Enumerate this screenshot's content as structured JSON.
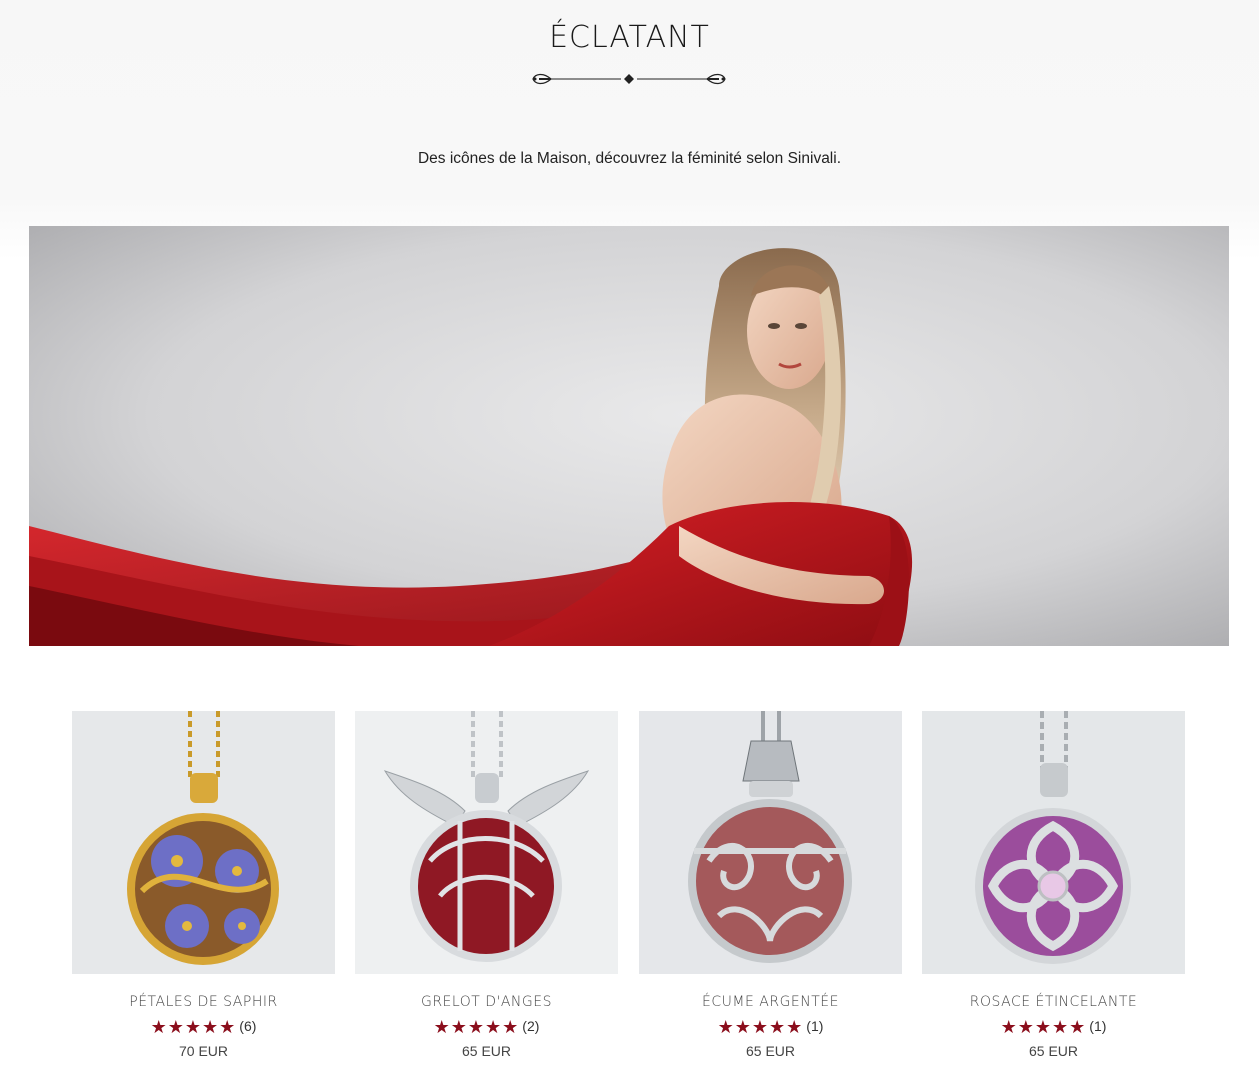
{
  "section": {
    "title": "ÉCLATANT",
    "subtitle": "Des icônes de la Maison, découvrez la féminité selon Sinivali."
  },
  "hero": {
    "alt_icon": "hero-model-red-dress-image"
  },
  "colors": {
    "star": "#8b0e1c",
    "dress_red": "#c8161d"
  },
  "products": [
    {
      "name": "PÉTALES DE SAPHIR",
      "stars": "★★★★★",
      "reviews": "(6)",
      "price": "70 EUR",
      "rating": 5,
      "image_icon": "gold-blue-flower-pendant-image"
    },
    {
      "name": "GRELOT D'ANGES",
      "stars": "★★★★★",
      "reviews": "(2)",
      "price": "65 EUR",
      "rating": 5,
      "image_icon": "silver-winged-red-pendant-image"
    },
    {
      "name": "ÉCUME ARGENTÉE",
      "stars": "★★★★★",
      "reviews": "(1)",
      "price": "65 EUR",
      "rating": 5,
      "image_icon": "silver-filigree-pendant-image"
    },
    {
      "name": "ROSACE ÉTINCELANTE",
      "stars": "★★★★★",
      "reviews": "(1)",
      "price": "65 EUR",
      "rating": 5,
      "image_icon": "silver-purple-rosette-pendant-image"
    }
  ]
}
